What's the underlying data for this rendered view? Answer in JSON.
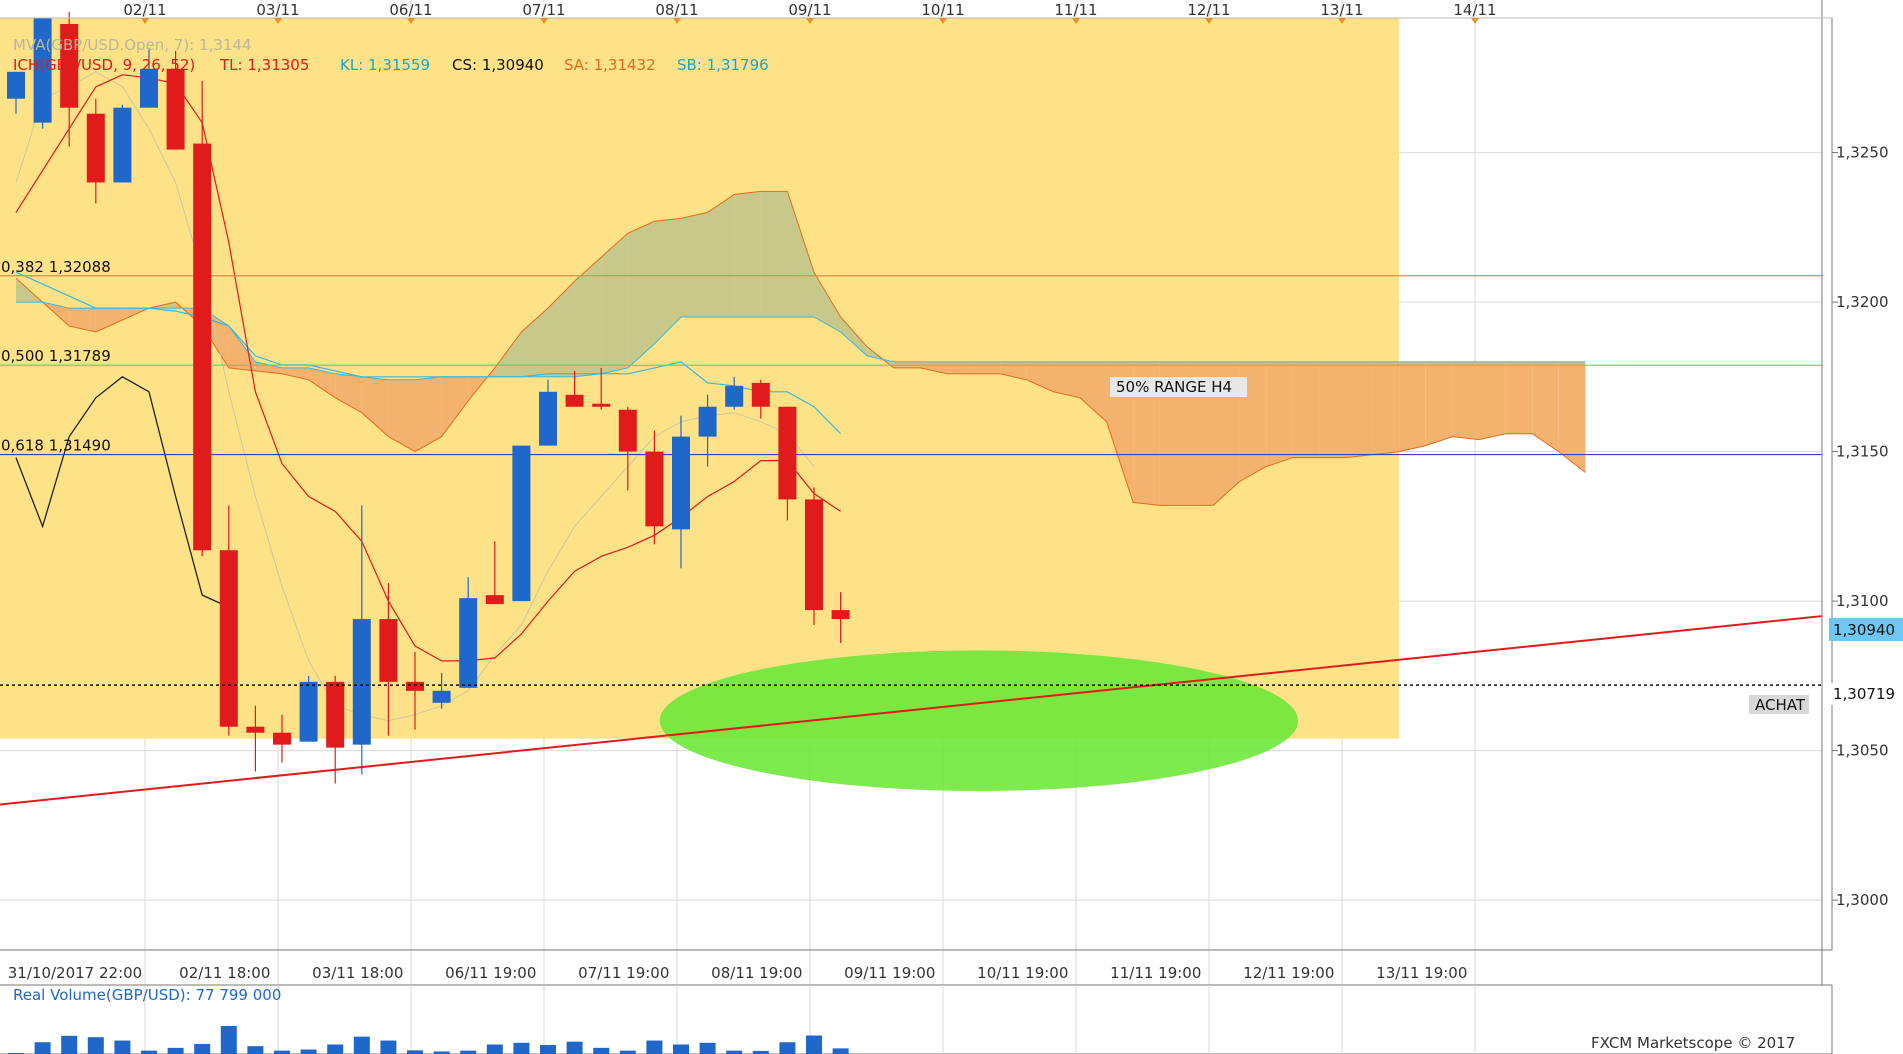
{
  "colors": {
    "background": "#ffffff",
    "grid": "#d9d9d9",
    "zone_fill": "#fde287",
    "candle_up": "#1f67c9",
    "candle_down": "#e11b1b",
    "cloud_bull": "#c8c88a",
    "cloud_bear": "#f4b26f",
    "tenkan": "#e11b1b",
    "kijun": "#37b8df",
    "chikou": "#222222",
    "mva": "#c8c8a0",
    "trendline": "#e11b1b",
    "fib_0382": "#f08a4b",
    "fib_0500": "#5fd45f",
    "fib_0618": "#3b3bc8",
    "target_ellipse": "#6fe83a",
    "price_tag_bg": "#6cc8f0",
    "order_tag_bg": "#d8d8d8",
    "volume_bar": "#1f67c9",
    "label_text_red": "#e11b1b",
    "label_text_cyan": "#1aa4d1",
    "label_text_orange": "#e46b1f"
  },
  "chart_data": {
    "type": "candlestick",
    "instrument": "GBP/USD",
    "y_range": [
      1.2985,
      1.3295
    ],
    "y_ticks": [
      "1,3250",
      "1,3200",
      "1,3150",
      "1,3100",
      "1,3050",
      "1,3000"
    ],
    "top_date_labels": [
      "02/11",
      "03/11",
      "06/11",
      "07/11",
      "08/11",
      "09/11",
      "10/11",
      "11/11",
      "12/11",
      "13/11",
      "14/11"
    ],
    "bottom_time_labels": [
      "31/10/2017 22:00",
      "02/11 18:00",
      "03/11 18:00",
      "06/11 19:00",
      "07/11 19:00",
      "08/11 19:00",
      "09/11 19:00",
      "10/11 19:00",
      "11/11 19:00",
      "12/11 19:00",
      "13/11 19:00"
    ],
    "indicator_header": {
      "mva": "MVA(GBP/USD.Open, 7): 1,3144",
      "ich_name": "ICH(GBP/USD, 9, 26, 52)",
      "tl": "TL: 1,31305",
      "kl": "KL: 1,31559",
      "cs": "CS: 1,30940",
      "sa": "SA: 1,31432",
      "sb": "SB: 1,31796"
    },
    "candles": [
      {
        "o": 1.3268,
        "h": 1.3275,
        "l": 1.3263,
        "c": 1.3277
      },
      {
        "o": 1.326,
        "h": 1.3295,
        "l": 1.3258,
        "c": 1.3295
      },
      {
        "o": 1.3293,
        "h": 1.3297,
        "l": 1.3252,
        "c": 1.3265
      },
      {
        "o": 1.3263,
        "h": 1.3268,
        "l": 1.3233,
        "c": 1.324
      },
      {
        "o": 1.324,
        "h": 1.3266,
        "l": 1.324,
        "c": 1.3265
      },
      {
        "o": 1.3265,
        "h": 1.3285,
        "l": 1.3265,
        "c": 1.3278
      },
      {
        "o": 1.3278,
        "h": 1.3284,
        "l": 1.3251,
        "c": 1.3251
      },
      {
        "o": 1.3253,
        "h": 1.3274,
        "l": 1.3115,
        "c": 1.3117
      },
      {
        "o": 1.3117,
        "h": 1.3132,
        "l": 1.3055,
        "c": 1.3058
      },
      {
        "o": 1.3058,
        "h": 1.3065,
        "l": 1.3043,
        "c": 1.3056
      },
      {
        "o": 1.3056,
        "h": 1.3062,
        "l": 1.3046,
        "c": 1.3052
      },
      {
        "o": 1.3053,
        "h": 1.3075,
        "l": 1.3053,
        "c": 1.3073
      },
      {
        "o": 1.3073,
        "h": 1.3075,
        "l": 1.3039,
        "c": 1.3051
      },
      {
        "o": 1.3052,
        "h": 1.3132,
        "l": 1.3042,
        "c": 1.3094
      },
      {
        "o": 1.3094,
        "h": 1.3106,
        "l": 1.3055,
        "c": 1.3073
      },
      {
        "o": 1.3073,
        "h": 1.3083,
        "l": 1.3057,
        "c": 1.307
      },
      {
        "o": 1.3066,
        "h": 1.3076,
        "l": 1.3064,
        "c": 1.307
      },
      {
        "o": 1.3071,
        "h": 1.3108,
        "l": 1.3071,
        "c": 1.3101
      },
      {
        "o": 1.3102,
        "h": 1.312,
        "l": 1.3099,
        "c": 1.3099
      },
      {
        "o": 1.31,
        "h": 1.3152,
        "l": 1.31,
        "c": 1.3152
      },
      {
        "o": 1.3152,
        "h": 1.3174,
        "l": 1.3152,
        "c": 1.317
      },
      {
        "o": 1.3169,
        "h": 1.3177,
        "l": 1.3165,
        "c": 1.3165
      },
      {
        "o": 1.3166,
        "h": 1.3178,
        "l": 1.3164,
        "c": 1.3165
      },
      {
        "o": 1.3164,
        "h": 1.3165,
        "l": 1.3137,
        "c": 1.315
      },
      {
        "o": 1.315,
        "h": 1.3157,
        "l": 1.3119,
        "c": 1.3125
      },
      {
        "o": 1.3124,
        "h": 1.3162,
        "l": 1.3111,
        "c": 1.3155
      },
      {
        "o": 1.3155,
        "h": 1.3169,
        "l": 1.3145,
        "c": 1.3165
      },
      {
        "o": 1.3165,
        "h": 1.3175,
        "l": 1.3164,
        "c": 1.3172
      },
      {
        "o": 1.3173,
        "h": 1.3174,
        "l": 1.3161,
        "c": 1.3165
      },
      {
        "o": 1.3165,
        "h": 1.3165,
        "l": 1.3127,
        "c": 1.3134
      },
      {
        "o": 1.3134,
        "h": 1.3138,
        "l": 1.3092,
        "c": 1.3097
      },
      {
        "o": 1.3097,
        "h": 1.3103,
        "l": 1.3086,
        "c": 1.3094
      }
    ],
    "tenkan": [
      1.323,
      1.3244,
      1.3258,
      1.3272,
      1.3276,
      1.3275,
      1.3273,
      1.326,
      1.322,
      1.317,
      1.3146,
      1.3135,
      1.313,
      1.312,
      1.31,
      1.3085,
      1.308,
      1.308,
      1.3081,
      1.3089,
      1.31,
      1.311,
      1.3115,
      1.3118,
      1.3122,
      1.3128,
      1.3135,
      1.314,
      1.3147,
      1.3147,
      1.3136,
      1.313
    ],
    "kijun": [
      1.321,
      1.3206,
      1.3202,
      1.3198,
      1.3198,
      1.3198,
      1.3197,
      1.3195,
      1.3192,
      1.3182,
      1.3179,
      1.3179,
      1.3177,
      1.3175,
      1.3175,
      1.3175,
      1.3175,
      1.3175,
      1.3175,
      1.3175,
      1.3176,
      1.3176,
      1.3176,
      1.3176,
      1.3178,
      1.318,
      1.3173,
      1.3172,
      1.317,
      1.317,
      1.3165,
      1.3156
    ],
    "chikou": [
      1.3148,
      1.3125,
      1.3155,
      1.3168,
      1.3175,
      1.317,
      1.3135,
      1.3102,
      1.3098
    ],
    "mva": [
      1.324,
      1.3268,
      1.3272,
      1.3277,
      1.3272,
      1.3258,
      1.324,
      1.321,
      1.317,
      1.3135,
      1.3105,
      1.308,
      1.3065,
      1.3062,
      1.306,
      1.3062,
      1.3065,
      1.307,
      1.3082,
      1.3092,
      1.311,
      1.3125,
      1.3135,
      1.3145,
      1.3155,
      1.316,
      1.3162,
      1.3163,
      1.316,
      1.3156,
      1.3145
    ],
    "cloud_senkou_a": [
      1.3208,
      1.32,
      1.3192,
      1.319,
      1.3194,
      1.3198,
      1.32,
      1.3192,
      1.3178,
      1.3177,
      1.3176,
      1.3174,
      1.3168,
      1.3163,
      1.3155,
      1.315,
      1.3155,
      1.3167,
      1.3178,
      1.319,
      1.3198,
      1.3207,
      1.3215,
      1.3223,
      1.3227,
      1.3228,
      1.323,
      1.3236,
      1.3237,
      1.3237,
      1.321,
      1.3195,
      1.3185,
      1.3178,
      1.3178,
      1.3176,
      1.3176,
      1.3176,
      1.3174,
      1.317,
      1.3168,
      1.316,
      1.3133,
      1.3132,
      1.3132,
      1.3132,
      1.314,
      1.3145,
      1.3148,
      1.3148,
      1.3148,
      1.3149,
      1.315,
      1.3152,
      1.3155,
      1.3154,
      1.3156,
      1.3156,
      1.315,
      1.3143
    ],
    "cloud_senkou_b": [
      1.32,
      1.32,
      1.3198,
      1.3198,
      1.3198,
      1.3198,
      1.3198,
      1.3198,
      1.3192,
      1.318,
      1.3178,
      1.3178,
      1.3176,
      1.3175,
      1.3174,
      1.3174,
      1.3175,
      1.3175,
      1.3175,
      1.3175,
      1.3175,
      1.3175,
      1.3176,
      1.3178,
      1.3186,
      1.3195,
      1.3195,
      1.3195,
      1.3195,
      1.3195,
      1.3195,
      1.319,
      1.3182,
      1.318,
      1.318,
      1.318,
      1.318,
      1.318,
      1.318,
      1.318,
      1.318,
      1.318,
      1.318,
      1.318,
      1.318,
      1.318,
      1.318,
      1.318,
      1.318,
      1.318,
      1.318,
      1.318,
      1.318,
      1.318,
      1.318,
      1.318,
      1.318,
      1.318,
      1.318,
      1.318
    ],
    "fib_levels": [
      {
        "label": "0,382 1,32088",
        "value": 1.32088,
        "key": "fib_0382"
      },
      {
        "label": "0,500 1,31789",
        "value": 1.31789,
        "key": "fib_0500"
      },
      {
        "label": "0,618 1,31490",
        "value": 1.3149,
        "key": "fib_0618"
      }
    ],
    "range_label": "50% RANGE H4",
    "range_value": 1.31789,
    "zone": {
      "y_low": 1.3054,
      "y_high": 1.3295,
      "end_bar": 52
    },
    "trendline": {
      "y_start": 1.3032,
      "y_end": 1.3095
    },
    "current_price": {
      "label": "1,30940",
      "value": 1.3094
    },
    "order_line": {
      "label": "1,30719",
      "value": 1.30719,
      "tag": "ACHAT"
    },
    "target_zone": {
      "center_bar": 36.2,
      "center_y": 1.306,
      "half_bars": 12,
      "half_y": 0.00235
    },
    "volume_title": "Real Volume(GBP/USD): 77 799 000",
    "volume": [
      0.0,
      0.42,
      0.65,
      0.6,
      0.48,
      0.12,
      0.22,
      0.36,
      1.0,
      0.28,
      0.12,
      0.16,
      0.34,
      0.62,
      0.48,
      0.13,
      0.09,
      0.12,
      0.34,
      0.4,
      0.32,
      0.44,
      0.22,
      0.12,
      0.48,
      0.34,
      0.4,
      0.12,
      0.11,
      0.42,
      0.66,
      0.2
    ],
    "watermark": "FXCM Marketscope © 2017"
  }
}
